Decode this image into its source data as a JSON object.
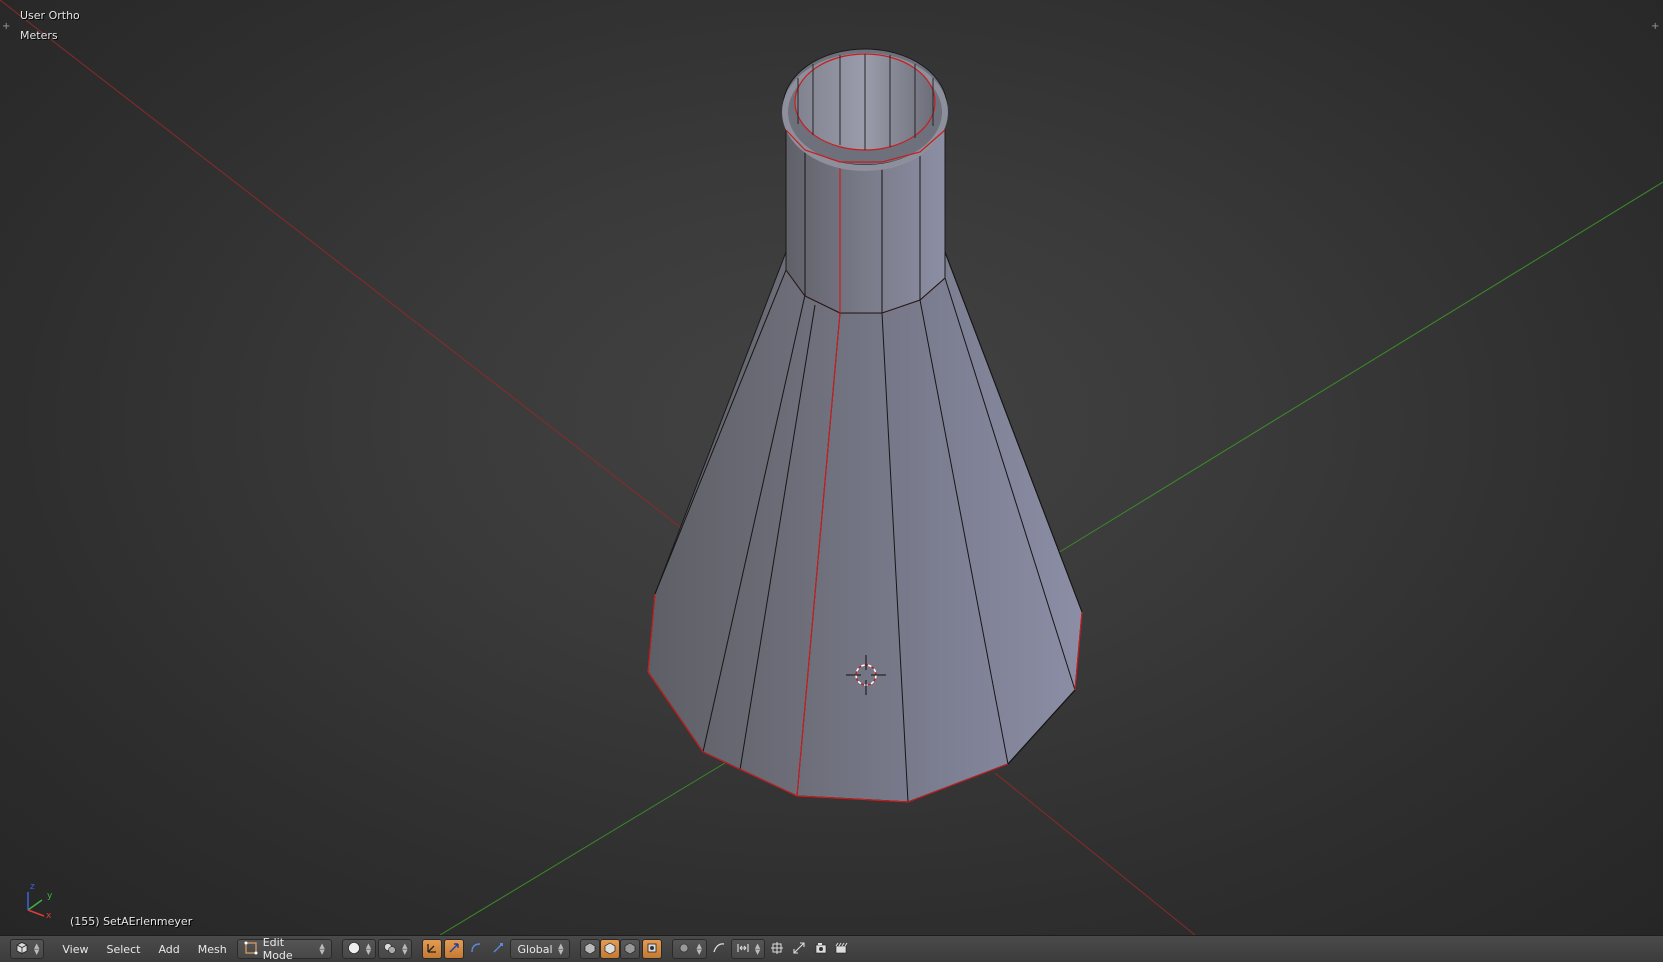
{
  "viewport": {
    "view_name": "User Ortho",
    "units": "Meters",
    "object_info": "(155) SetAErlenmeyer",
    "axis_labels": {
      "x": "x",
      "y": "y",
      "z": "z"
    }
  },
  "header": {
    "editor_type_icon": "3d-view-icon",
    "menus": [
      "View",
      "Select",
      "Add",
      "Mesh"
    ],
    "mode": "Edit Mode",
    "viewport_shading_icon": "solid-sphere-icon",
    "pivot_icon": "pivot-point-icon",
    "manipulator_icons": [
      "manipulator-toggle-icon",
      "translate-icon",
      "rotate-icon",
      "scale-icon"
    ],
    "orientation": "Global",
    "select_mode_icons": [
      "vertex-select-icon",
      "edge-select-icon",
      "face-select-icon"
    ],
    "occlude_icon": "limit-selection-icon",
    "proportional_icon": "proportional-edit-icon",
    "falloff_icon": "falloff-icon",
    "snap_icons": [
      "snap-toggle-icon",
      "snap-element-icon",
      "snap-target-icon"
    ],
    "render_icons": [
      "opengl-render-icon",
      "opengl-anim-icon"
    ]
  },
  "colors": {
    "x_axis": "#a52a2a",
    "y_axis": "#3c8c28",
    "mesh_face": "#7c7e92",
    "seam_edge": "#d02020",
    "active_button": "#d88a45"
  }
}
